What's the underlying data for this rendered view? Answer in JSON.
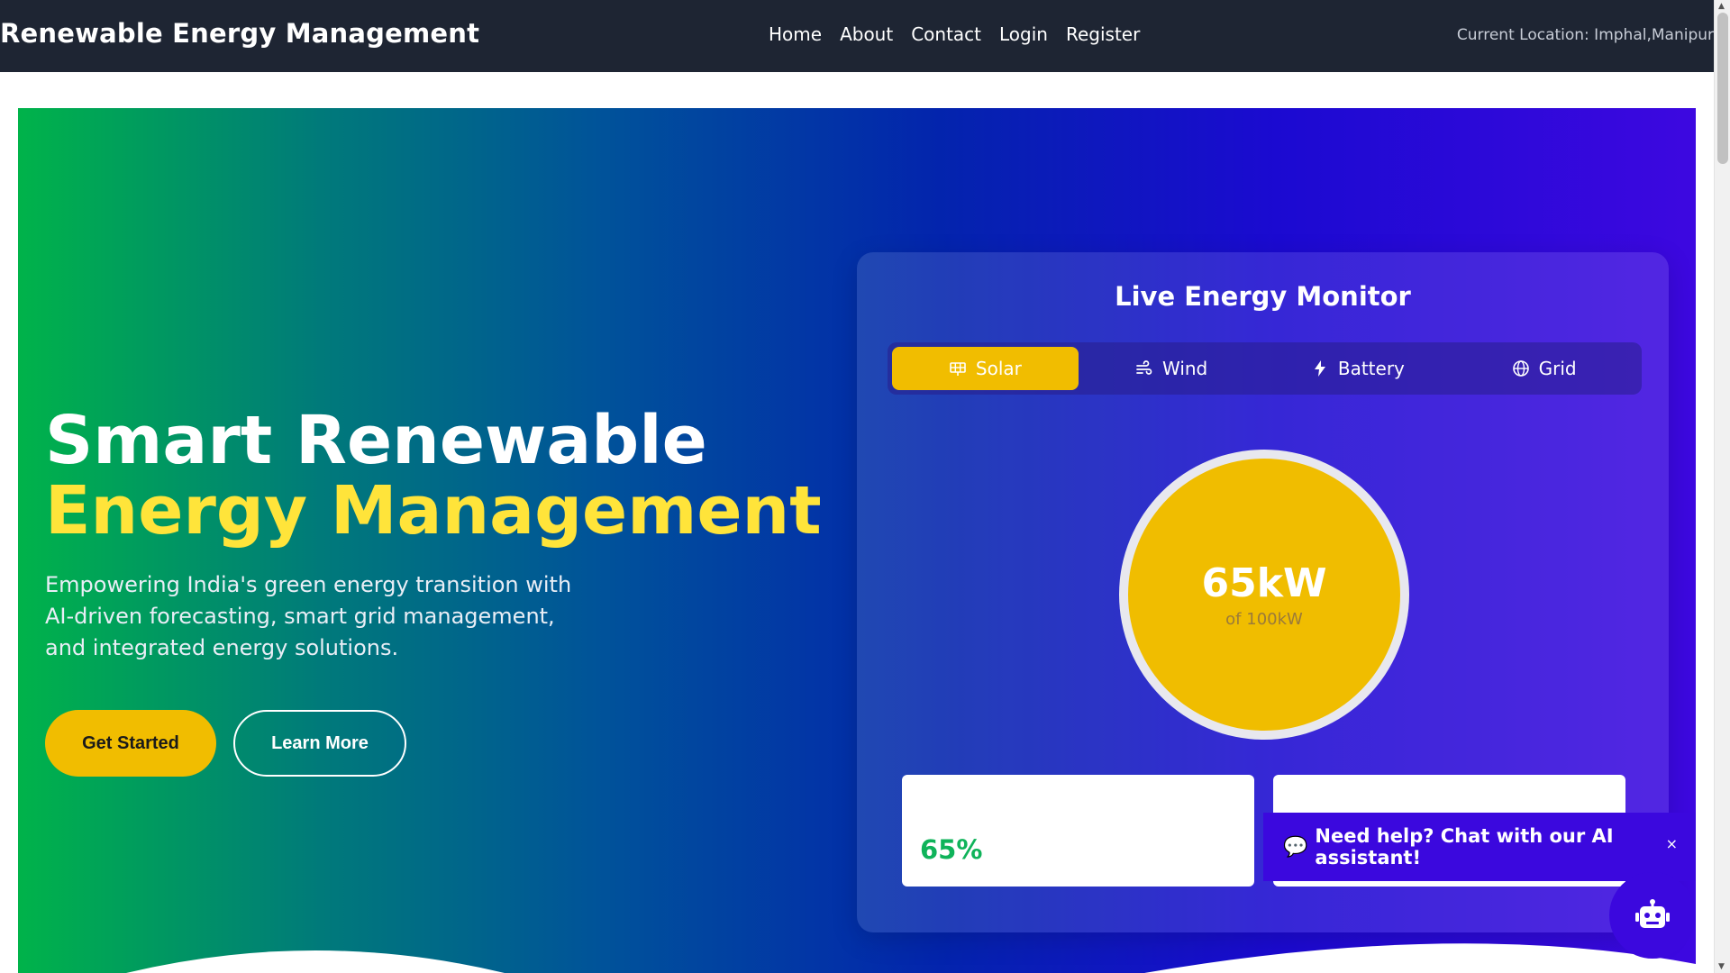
{
  "navbar": {
    "brand": "Renewable Energy Management",
    "links": [
      "Home",
      "About",
      "Contact",
      "Login",
      "Register"
    ],
    "location": "Current Location: Imphal,Manipur"
  },
  "hero": {
    "title_line1": "Smart Renewable",
    "title_line2": "Energy Management",
    "description": "Empowering India's green energy transition with AI-driven forecasting, smart grid management, and integrated energy solutions.",
    "primary_button": "Get Started",
    "secondary_button": "Learn More"
  },
  "monitor": {
    "title": "Live Energy Monitor",
    "tabs": [
      {
        "label": "Solar",
        "icon": "solar-panel-icon",
        "active": true
      },
      {
        "label": "Wind",
        "icon": "wind-icon",
        "active": false
      },
      {
        "label": "Battery",
        "icon": "bolt-icon",
        "active": false
      },
      {
        "label": "Grid",
        "icon": "globe-icon",
        "active": false
      }
    ],
    "gauge_value": "65kW",
    "gauge_sub": "of 100kW",
    "card_value": "65%"
  },
  "chat": {
    "banner_text": "Need help? Chat with our AI assistant!",
    "close_label": "×"
  },
  "colors": {
    "accent": "#f1bd00",
    "navbar": "#1e2533",
    "chat": "#3b08de",
    "success": "#0fb35a"
  }
}
